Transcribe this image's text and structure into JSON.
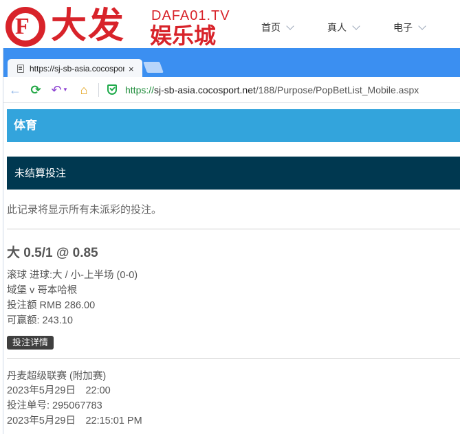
{
  "site": {
    "logo_big": "大发",
    "logo_domain": "DAFA01.TV",
    "logo_sub": "娱乐城",
    "logo_letter": "F",
    "nav": [
      {
        "label": "首页"
      },
      {
        "label": "真人"
      },
      {
        "label": "电子"
      }
    ]
  },
  "browser": {
    "tab_title": "https://sj-sb-asia.cocosport.net/188/Purpose/PopBetList_Mobile.aspx",
    "tab_close": "×",
    "url_secure": "https://",
    "url_host": "sj-sb-asia.cocosport.net",
    "url_path": "/188/Purpose/PopBetList_Mobile.aspx",
    "icons": {
      "back": "←",
      "reload": "⟳",
      "undo": "↶",
      "dropdown": "▼",
      "home": "⌂"
    }
  },
  "page": {
    "sport_header": "体育",
    "section_header": "未结算投注",
    "note": "此记录将显示所有未派彩的投注。",
    "bet": {
      "pick": "大 0.5/1 @ 0.85",
      "market": "滚球 进球:大 / 小-上半场 (0-0)",
      "match": "域堡 v 哥本哈根",
      "stake": "投注额 RMB 286.00",
      "to_win": "可赢额: 243.10",
      "details_button": "投注详情",
      "league": "丹麦超级联赛 (附加赛)",
      "match_time": "2023年5月29日　22:00",
      "ticket_no": "投注单号: 295067783",
      "bet_time": "2023年5月29日　22:15:01 PM"
    }
  },
  "colors": {
    "brand_red": "#d8232a",
    "tabbar_blue": "#3b8ff1",
    "sport_bar": "#33a4dc",
    "section_bar": "#003850",
    "secure_green": "#1e8c3a"
  }
}
